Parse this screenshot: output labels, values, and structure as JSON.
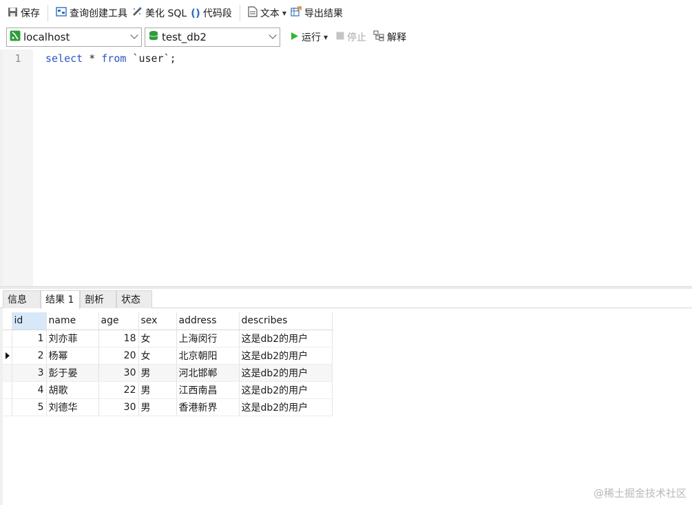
{
  "toolbar": {
    "save": "保存",
    "query_builder": "查询创建工具",
    "beautify_sql": "美化 SQL",
    "snippet": "代码段",
    "text": "文本",
    "export_results": "导出结果"
  },
  "connection": {
    "server": "localhost",
    "database": "test_db2",
    "run": "运行",
    "stop": "停止",
    "explain": "解释"
  },
  "editor": {
    "line_number": "1",
    "tokens": {
      "select": "select",
      "star": " * ",
      "from": "from",
      "table": " `user`;"
    }
  },
  "tabs": [
    "信息",
    "结果 1",
    "剖析",
    "状态"
  ],
  "results": {
    "columns": [
      "id",
      "name",
      "age",
      "sex",
      "address",
      "describes"
    ],
    "rows": [
      [
        "1",
        "刘亦菲",
        "18",
        "女",
        "上海闵行",
        "这是db2的用户"
      ],
      [
        "2",
        "杨幂",
        "20",
        "女",
        "北京朝阳",
        "这是db2的用户"
      ],
      [
        "3",
        "彭于晏",
        "30",
        "男",
        "河北邯郸",
        "这是db2的用户"
      ],
      [
        "4",
        "胡歌",
        "22",
        "男",
        "江西南昌",
        "这是db2的用户"
      ],
      [
        "5",
        "刘德华",
        "30",
        "男",
        "香港新界",
        "这是db2的用户"
      ]
    ]
  },
  "watermark": "@稀土掘金技术社区",
  "colors": {
    "keyword": "#2a55c8",
    "run_green": "#2eb82e",
    "db_green": "#2e9e3a",
    "selected_header": "#d7e8f8"
  },
  "icons": [
    "save-icon",
    "query-builder-icon",
    "beautify-icon",
    "snippet-icon",
    "text-icon",
    "export-icon",
    "connection-icon",
    "database-icon",
    "run-icon",
    "stop-icon",
    "explain-icon"
  ]
}
